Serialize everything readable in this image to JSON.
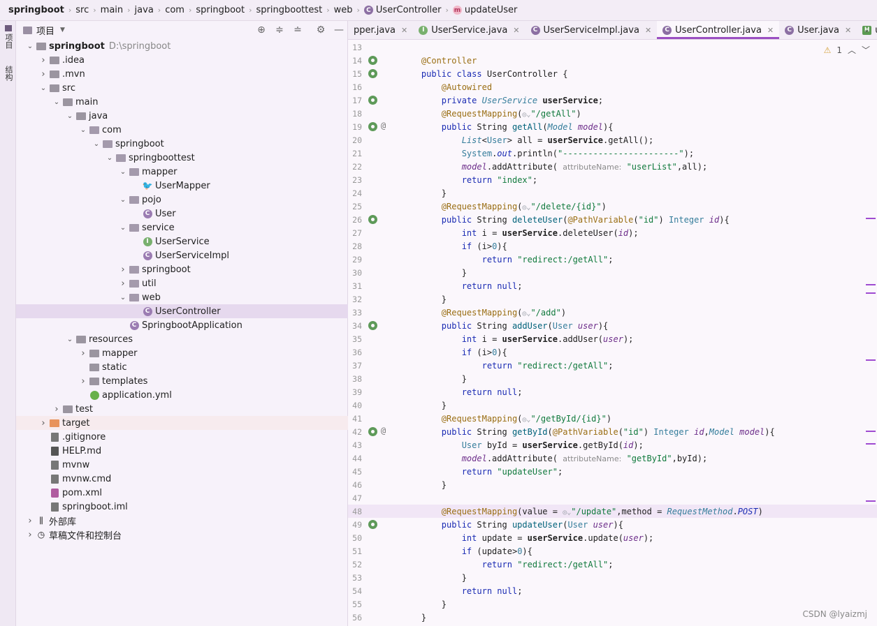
{
  "breadcrumb": [
    {
      "label": "springboot",
      "icon": ""
    },
    {
      "label": "src",
      "icon": ""
    },
    {
      "label": "main",
      "icon": ""
    },
    {
      "label": "java",
      "icon": ""
    },
    {
      "label": "com",
      "icon": ""
    },
    {
      "label": "springboot",
      "icon": ""
    },
    {
      "label": "springboottest",
      "icon": ""
    },
    {
      "label": "web",
      "icon": ""
    },
    {
      "label": "UserController",
      "icon": "class-icon"
    },
    {
      "label": "updateUser",
      "icon": "method-icon"
    }
  ],
  "left_strip": {
    "project_label": "项目",
    "structure_label": "结构"
  },
  "project_panel": {
    "title": "项目",
    "tree": [
      {
        "label": "springboot",
        "path": "D:\\springboot",
        "depth": 0,
        "expanded": true,
        "type": "module"
      },
      {
        "label": ".idea",
        "depth": 1,
        "expanded": false,
        "type": "folder"
      },
      {
        "label": ".mvn",
        "depth": 1,
        "expanded": false,
        "type": "folder"
      },
      {
        "label": "src",
        "depth": 1,
        "expanded": true,
        "type": "folder"
      },
      {
        "label": "main",
        "depth": 2,
        "expanded": true,
        "type": "folder"
      },
      {
        "label": "java",
        "depth": 3,
        "expanded": true,
        "type": "folder"
      },
      {
        "label": "com",
        "depth": 4,
        "expanded": true,
        "type": "package"
      },
      {
        "label": "springboot",
        "depth": 5,
        "expanded": true,
        "type": "package"
      },
      {
        "label": "springboottest",
        "depth": 6,
        "expanded": true,
        "type": "package"
      },
      {
        "label": "mapper",
        "depth": 7,
        "expanded": true,
        "type": "package"
      },
      {
        "label": "UserMapper",
        "depth": 8,
        "type": "mybatis"
      },
      {
        "label": "pojo",
        "depth": 7,
        "expanded": true,
        "type": "package"
      },
      {
        "label": "User",
        "depth": 8,
        "type": "class"
      },
      {
        "label": "service",
        "depth": 7,
        "expanded": true,
        "type": "package"
      },
      {
        "label": "UserService",
        "depth": 8,
        "type": "interface"
      },
      {
        "label": "UserServiceImpl",
        "depth": 8,
        "type": "class"
      },
      {
        "label": "springboot",
        "depth": 7,
        "expanded": false,
        "type": "package"
      },
      {
        "label": "util",
        "depth": 7,
        "expanded": false,
        "type": "package"
      },
      {
        "label": "web",
        "depth": 7,
        "expanded": true,
        "type": "package"
      },
      {
        "label": "UserController",
        "depth": 8,
        "type": "class",
        "selected": true
      },
      {
        "label": "SpringbootApplication",
        "depth": 7,
        "type": "app"
      },
      {
        "label": "resources",
        "depth": 3,
        "expanded": true,
        "type": "folder"
      },
      {
        "label": "mapper",
        "depth": 4,
        "expanded": false,
        "type": "folder"
      },
      {
        "label": "static",
        "depth": 4,
        "type": "folder-leaf"
      },
      {
        "label": "templates",
        "depth": 4,
        "expanded": false,
        "type": "folder"
      },
      {
        "label": "application.yml",
        "depth": 4,
        "type": "yml"
      },
      {
        "label": "test",
        "depth": 2,
        "expanded": false,
        "type": "folder"
      },
      {
        "label": "target",
        "depth": 1,
        "expanded": false,
        "type": "folder-orange",
        "highlight": true
      },
      {
        "label": ".gitignore",
        "depth": 1,
        "type": "file"
      },
      {
        "label": "HELP.md",
        "depth": 1,
        "type": "md"
      },
      {
        "label": "mvnw",
        "depth": 1,
        "type": "file"
      },
      {
        "label": "mvnw.cmd",
        "depth": 1,
        "type": "file"
      },
      {
        "label": "pom.xml",
        "depth": 1,
        "type": "xml"
      },
      {
        "label": "springboot.iml",
        "depth": 1,
        "type": "file"
      },
      {
        "label": "外部库",
        "depth": 0,
        "expanded": false,
        "type": "libs"
      },
      {
        "label": "草稿文件和控制台",
        "depth": 0,
        "expanded": false,
        "type": "scratch"
      }
    ]
  },
  "tabs": [
    {
      "label": "pper.java",
      "icon": "",
      "active": false
    },
    {
      "label": "UserService.java",
      "icon": "i",
      "active": false
    },
    {
      "label": "UserServiceImpl.java",
      "icon": "c",
      "active": false
    },
    {
      "label": "UserController.java",
      "icon": "c",
      "active": true
    },
    {
      "label": "User.java",
      "icon": "c",
      "active": false
    },
    {
      "label": "update",
      "icon": "h",
      "active": false
    }
  ],
  "editor_status": {
    "warnings": "1"
  },
  "code_lines": [
    {
      "n": "13",
      "html": ""
    },
    {
      "n": "14",
      "gutter": "bean",
      "html": "    <span class='annot'>@Controller</span>"
    },
    {
      "n": "15",
      "gutter": "bean",
      "html": "    <span class='kw'>public class</span> UserController {"
    },
    {
      "n": "16",
      "html": "        <span class='annot'>@Autowired</span>"
    },
    {
      "n": "17",
      "gutter": "bean",
      "html": "        <span class='kw'>private</span> <span class='typ ital'>UserService</span> <b>userService</b>;"
    },
    {
      "n": "18",
      "html": "        <span class='annot'>@RequestMapping</span>(<span class='inc'>◎⌄</span><span class='str'>\"/getAll\"</span>)"
    },
    {
      "n": "19",
      "gutter": "bean",
      "at": true,
      "html": "        <span class='kw'>public</span> String <span class='fn'>getAll</span>(<span class='ital typ'>Model</span> <span class='param'>model</span>){"
    },
    {
      "n": "20",
      "html": "            <span class='ital typ'>List</span>&lt;<span class='typ'>User</span>&gt; all = <b>userService</b>.getAll();"
    },
    {
      "n": "21",
      "html": "            <span class='typ'>System</span>.<span class='ital kw'>out</span>.println(<span class='str'>\"-----------------------\"</span>);"
    },
    {
      "n": "22",
      "html": "            <span class='param'>model</span>.addAttribute( <span class='hint'>attributeName:</span> <span class='str'>\"userList\"</span>,all);"
    },
    {
      "n": "23",
      "html": "            <span class='kw'>return</span> <span class='str'>\"index\"</span>;"
    },
    {
      "n": "24",
      "html": "        }"
    },
    {
      "n": "25",
      "html": "        <span class='annot'>@RequestMapping</span>(<span class='inc'>◎⌄</span><span class='str'>\"/delete/{id}\"</span>)"
    },
    {
      "n": "26",
      "gutter": "bean",
      "html": "        <span class='kw'>public</span> String <span class='fn'>deleteUser</span>(<span class='annot'>@PathVariable</span>(<span class='str'>\"id\"</span>) <span class='typ'>Integer</span> <span class='param'>id</span>){"
    },
    {
      "n": "27",
      "html": "            <span class='kw'>int</span> i = <b>userService</b>.deleteUser(<span class='param'>id</span>);"
    },
    {
      "n": "28",
      "html": "            <span class='kw'>if</span> (i&gt;<span class='typ'>0</span>){"
    },
    {
      "n": "29",
      "html": "                <span class='kw'>return</span> <span class='str'>\"redirect:/getAll\"</span>;"
    },
    {
      "n": "30",
      "html": "            }"
    },
    {
      "n": "31",
      "html": "            <span class='kw'>return null</span>;"
    },
    {
      "n": "32",
      "html": "        }"
    },
    {
      "n": "33",
      "html": "        <span class='annot'>@RequestMapping</span>(<span class='inc'>◎⌄</span><span class='str'>\"/add\"</span>)"
    },
    {
      "n": "34",
      "gutter": "bean",
      "html": "        <span class='kw'>public</span> String <span class='fn'>addUser</span>(<span class='typ'>User</span> <span class='param'>user</span>){"
    },
    {
      "n": "35",
      "html": "            <span class='kw'>int</span> i = <b>userService</b>.addUser(<span class='param'>user</span>);"
    },
    {
      "n": "36",
      "html": "            <span class='kw'>if</span> (i&gt;<span class='typ'>0</span>){"
    },
    {
      "n": "37",
      "html": "                <span class='kw'>return</span> <span class='str'>\"redirect:/getAll\"</span>;"
    },
    {
      "n": "38",
      "html": "            }"
    },
    {
      "n": "39",
      "html": "            <span class='kw'>return null</span>;"
    },
    {
      "n": "40",
      "html": "        }"
    },
    {
      "n": "41",
      "html": "        <span class='annot'>@RequestMapping</span>(<span class='inc'>◎⌄</span><span class='str'>\"/getById/{id}\"</span>)"
    },
    {
      "n": "42",
      "gutter": "bean",
      "at": true,
      "html": "        <span class='kw'>public</span> String <span class='fn'>getById</span>(<span class='annot'>@PathVariable</span>(<span class='str'>\"id\"</span>) <span class='typ'>Integer</span> <span class='param'>id</span>,<span class='ital typ'>Model</span> <span class='param'>model</span>){"
    },
    {
      "n": "43",
      "html": "            <span class='typ'>User</span> byId = <b>userService</b>.getById(<span class='param'>id</span>);"
    },
    {
      "n": "44",
      "html": "            <span class='param'>model</span>.addAttribute( <span class='hint'>attributeName:</span> <span class='str'>\"getById\"</span>,byId);"
    },
    {
      "n": "45",
      "html": "            <span class='kw'>return</span> <span class='str'>\"updateUser\"</span>;"
    },
    {
      "n": "46",
      "html": "        }"
    },
    {
      "n": "47",
      "html": ""
    },
    {
      "n": "48",
      "current": true,
      "html": "        <span class='annot'>@RequestMapping</span>(value = <span class='inc'>◎⌄</span><span class='str'>\"/update\"</span>,method = <span class='typ ital'>RequestMethod</span>.<span class='kw ital'>POST</span>)"
    },
    {
      "n": "49",
      "gutter": "bean",
      "html": "        <span class='kw'>public</span> String <span class='fn'>updateUser</span>(<span class='typ'>User</span> <span class='param'>user</span>){"
    },
    {
      "n": "50",
      "html": "            <span class='kw'>int</span> update = <b>userService</b>.update(<span class='param'>user</span>);"
    },
    {
      "n": "51",
      "html": "            <span class='kw'>if</span> (update&gt;<span class='typ'>0</span>){"
    },
    {
      "n": "52",
      "html": "                <span class='kw'>return</span> <span class='str'>\"redirect:/getAll\"</span>;"
    },
    {
      "n": "53",
      "html": "            }"
    },
    {
      "n": "54",
      "html": "            <span class='kw'>return null</span>;"
    },
    {
      "n": "55",
      "html": "        }"
    },
    {
      "n": "56",
      "html": "    }"
    }
  ],
  "watermark": "CSDN @lyaizmj",
  "colors": {
    "accent": "#9b4fc2",
    "selected_row": "#e6d9ee",
    "panel_bg": "#f7f2fa"
  }
}
